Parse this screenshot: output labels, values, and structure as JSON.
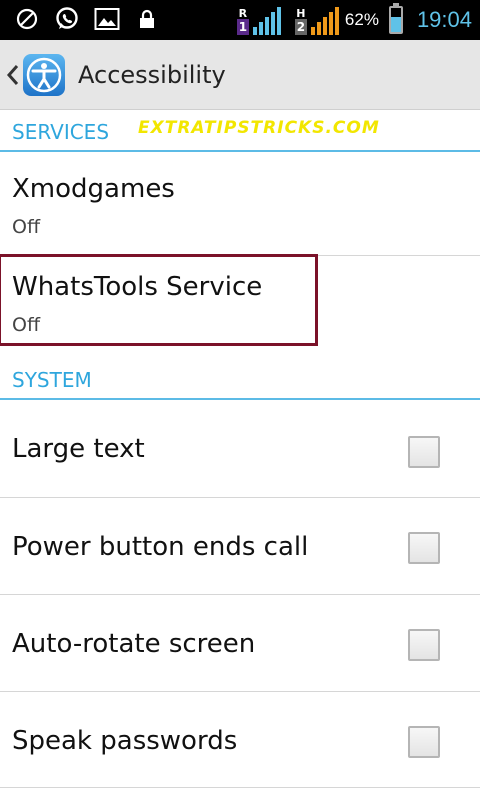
{
  "status_bar": {
    "icons": [
      "no-entry-icon",
      "whatsapp-icon",
      "image-icon",
      "lock-icon"
    ],
    "sim1": {
      "network": "R",
      "number": "1",
      "color": "#5fc2e8"
    },
    "sim2": {
      "network": "H",
      "number": "2",
      "color": "#f09a1a"
    },
    "battery_percent": "62%",
    "battery_level": 0.62,
    "time": "19:04"
  },
  "header": {
    "title": "Accessibility",
    "icon": "accessibility-icon"
  },
  "watermark": "EXTRATIPSTRICKS.COM",
  "sections": {
    "services": {
      "title": "SERVICES",
      "items": [
        {
          "title": "Xmodgames",
          "status": "Off"
        },
        {
          "title": "WhatsTools Service",
          "status": "Off"
        }
      ]
    },
    "system": {
      "title": "SYSTEM",
      "items": [
        {
          "title": "Large text",
          "checked": false
        },
        {
          "title": "Power button ends call",
          "checked": false
        },
        {
          "title": "Auto-rotate screen",
          "checked": false
        },
        {
          "title": "Speak passwords",
          "checked": false
        }
      ]
    }
  },
  "colors": {
    "accent": "#2ea6dd",
    "highlight_border": "#7b1229",
    "watermark": "#f2e600"
  }
}
